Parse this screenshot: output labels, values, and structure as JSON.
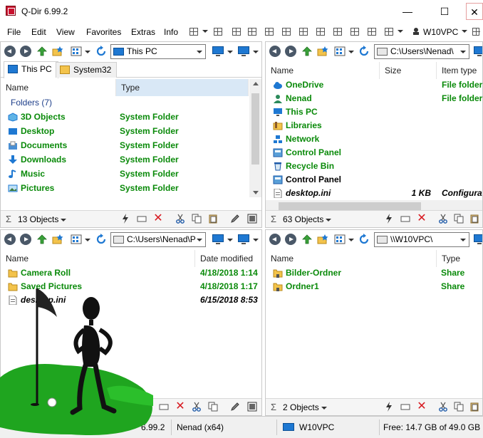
{
  "window": {
    "title": "Q-Dir 6.99.2",
    "min": "—",
    "max": "☐",
    "close": "✕"
  },
  "menu": {
    "items": [
      "File",
      "Edit",
      "View",
      "Favorites",
      "Extras",
      "Info"
    ],
    "host": "W10VPC",
    "host_badge": "inst"
  },
  "pane1": {
    "address": "This PC",
    "tabs": [
      "This PC",
      "System32"
    ],
    "columns": [
      "Name",
      "Type"
    ],
    "group": "Folders (7)",
    "rows": [
      {
        "name": "3D Objects",
        "type": "System Folder",
        "icon": "cube-icon"
      },
      {
        "name": "Desktop",
        "type": "System Folder",
        "icon": "desktop-icon"
      },
      {
        "name": "Documents",
        "type": "System Folder",
        "icon": "documents-icon"
      },
      {
        "name": "Downloads",
        "type": "System Folder",
        "icon": "download-arrow-icon"
      },
      {
        "name": "Music",
        "type": "System Folder",
        "icon": "music-note-icon"
      },
      {
        "name": "Pictures",
        "type": "System Folder",
        "icon": "pictures-icon"
      }
    ],
    "status": "13 Objects"
  },
  "pane2": {
    "address": "C:\\Users\\Nenad\\",
    "columns": [
      "Name",
      "Size",
      "Item type"
    ],
    "rows": [
      {
        "name": "OneDrive",
        "size": "",
        "type": "File folder",
        "icon": "cloud-icon"
      },
      {
        "name": "Nenad",
        "size": "",
        "type": "File folder",
        "icon": "user-icon"
      },
      {
        "name": "This PC",
        "size": "",
        "type": "",
        "icon": "monitor-icon"
      },
      {
        "name": "Libraries",
        "size": "",
        "type": "",
        "icon": "libraries-icon"
      },
      {
        "name": "Network",
        "size": "",
        "type": "",
        "icon": "network-icon"
      },
      {
        "name": "Control Panel",
        "size": "",
        "type": "",
        "icon": "control-panel-icon"
      },
      {
        "name": "Recycle Bin",
        "size": "",
        "type": "",
        "icon": "recycle-bin-icon"
      },
      {
        "name": "Control Panel",
        "size": "",
        "type": "",
        "icon": "control-panel-icon"
      },
      {
        "name": "desktop.ini",
        "size": "1 KB",
        "type": "Configura",
        "icon": "ini-file-icon"
      }
    ],
    "status": "63 Objects"
  },
  "pane3": {
    "address": "C:\\Users\\Nenad\\P",
    "columns": [
      "Name",
      "Date modified"
    ],
    "rows": [
      {
        "name": "Camera Roll",
        "date": "4/18/2018 1:14",
        "icon": "folder-icon"
      },
      {
        "name": "Saved Pictures",
        "date": "4/18/2018 1:17",
        "icon": "folder-icon"
      },
      {
        "name": "desktop.ini",
        "date": "6/15/2018 8:53",
        "icon": "ini-file-icon"
      }
    ]
  },
  "pane4": {
    "address": "\\\\W10VPC\\",
    "columns": [
      "Name",
      "Type"
    ],
    "rows": [
      {
        "name": "Bilder-Ordner",
        "type": "Share",
        "icon": "share-folder-icon"
      },
      {
        "name": "Ordner1",
        "type": "Share",
        "icon": "share-folder-icon"
      }
    ],
    "status": "2 Objects"
  },
  "appstatus": {
    "version": "6.99.2",
    "user": "Nenad (x64)",
    "host": "W10VPC",
    "free": "Free: 14.7 GB of 49.0 GB"
  },
  "colors": {
    "green_text": "#0a8a0a",
    "accent_blue": "#1e78d2",
    "delete_red": "#d71920",
    "header_sorted": "#d9e8f6"
  }
}
